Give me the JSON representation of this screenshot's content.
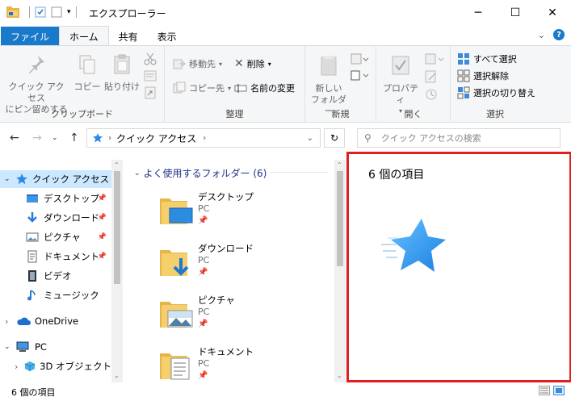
{
  "window": {
    "title": "エクスプローラー",
    "buttons": {
      "minimize": "─",
      "maximize": "☐",
      "close": "✕"
    }
  },
  "tabs": [
    {
      "label": "ファイル"
    },
    {
      "label": "ホーム"
    },
    {
      "label": "共有"
    },
    {
      "label": "表示"
    }
  ],
  "ribbon": {
    "clipboard": {
      "group_label": "クリップボード",
      "pin_quick_access": "クイック アクセス\nにピン留めする",
      "pin_line1": "クイック アクセス",
      "pin_line2": "にピン留めする",
      "copy": "コピー",
      "paste": "貼り付け"
    },
    "organize": {
      "group_label": "整理",
      "move_to": "移動先",
      "copy_to": "コピー先",
      "delete": "削除",
      "rename": "名前の変更"
    },
    "new": {
      "group_label": "新規",
      "new_folder_line1": "新しい",
      "new_folder_line2": "フォルダー"
    },
    "open": {
      "group_label": "開く",
      "properties": "プロパティ"
    },
    "select": {
      "group_label": "選択",
      "select_all": "すべて選択",
      "select_none": "選択解除",
      "invert_selection": "選択の切り替え"
    }
  },
  "address": {
    "path": "クイック アクセス",
    "search_placeholder": "クイック アクセスの検索"
  },
  "navpane": {
    "items": [
      {
        "label": "クイック アクセス",
        "icon": "star-icon"
      },
      {
        "label": "デスクトップ",
        "icon": "desktop-icon"
      },
      {
        "label": "ダウンロード",
        "icon": "download-icon"
      },
      {
        "label": "ピクチャ",
        "icon": "pictures-icon"
      },
      {
        "label": "ドキュメント",
        "icon": "documents-icon"
      },
      {
        "label": "ビデオ",
        "icon": "video-icon"
      },
      {
        "label": "ミュージック",
        "icon": "music-icon"
      },
      {
        "label": "OneDrive",
        "icon": "cloud-icon"
      },
      {
        "label": "PC",
        "icon": "pc-icon"
      },
      {
        "label": "3D オブジェクト",
        "icon": "3d-objects-icon"
      }
    ]
  },
  "content": {
    "group_header": "よく使用するフォルダー (6)",
    "folders": [
      {
        "name": "デスクトップ",
        "location": "PC"
      },
      {
        "name": "ダウンロード",
        "location": "PC"
      },
      {
        "name": "ピクチャ",
        "location": "PC"
      },
      {
        "name": "ドキュメント",
        "location": "PC"
      }
    ]
  },
  "details": {
    "count_text": "6 個の項目"
  },
  "status": {
    "count_text": "6 個の項目"
  },
  "colors": {
    "accent": "#1979ca",
    "selection": "#cce8ff",
    "highlight_border": "#e02020"
  }
}
